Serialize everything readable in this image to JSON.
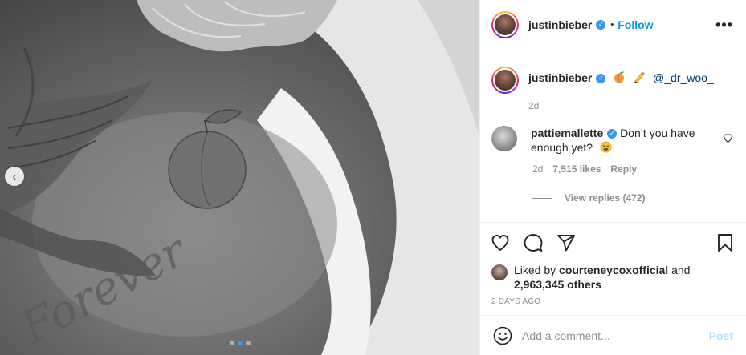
{
  "header": {
    "username": "justinbieber",
    "separator": "•",
    "follow_label": "Follow",
    "more_icon": "more-options-icon",
    "more_glyph": "•••"
  },
  "caption": {
    "username": "justinbieber",
    "emojis": [
      "peach",
      "pencil"
    ],
    "mention": "@_dr_woo_",
    "time": "2d"
  },
  "comment": {
    "username": "pattiemallette",
    "text": "Don’t you have enough yet?",
    "emoji": "tired-face",
    "time": "2d",
    "likes": "7,515 likes",
    "reply_label": "Reply",
    "view_replies": "View replies (472)"
  },
  "likes": {
    "prefix": "Liked by",
    "user": "courteneycoxofficial",
    "and": "and",
    "others": "2,963,345 others"
  },
  "date": "2 DAYS AGO",
  "add_comment": {
    "placeholder": "Add a comment...",
    "post_label": "Post"
  },
  "carousel": {
    "prev_glyph": "‹",
    "slides": 3,
    "active_slide": 2
  },
  "colors": {
    "link_blue": "#0095f6",
    "verified_blue": "#3897f0",
    "muted_gray": "#8e8e8e",
    "post_disabled": "#b2dffc"
  }
}
